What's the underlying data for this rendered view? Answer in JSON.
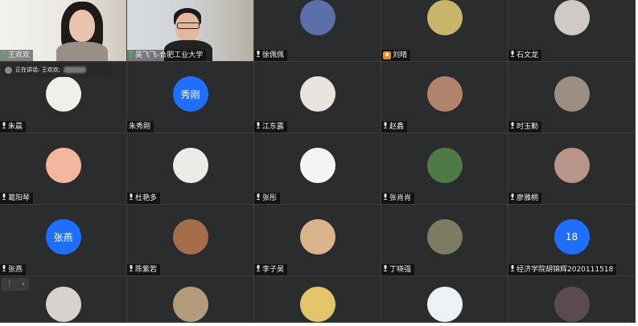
{
  "participants": [
    {
      "name": "王欢欢",
      "type": "video",
      "mic": true
    },
    {
      "name": "吴飞飞-合肥工业大学",
      "type": "video",
      "mic": true
    },
    {
      "name": "徐佩佩",
      "type": "image",
      "color": "#5b6fa8",
      "mic": true
    },
    {
      "name": "刘晴",
      "type": "image",
      "color": "#c9b56a",
      "badge": true
    },
    {
      "name": "石文龙",
      "type": "image",
      "color": "#cfcac4",
      "mic": true
    },
    {
      "name": "朱晨",
      "type": "image",
      "color": "#f1efe9",
      "mic": true
    },
    {
      "name": "朱秀刚",
      "type": "text",
      "text": "秀刚"
    },
    {
      "name": "江东露",
      "type": "image",
      "color": "#e8e4dd",
      "mic": true
    },
    {
      "name": "赵鑫",
      "type": "image",
      "color": "#b0836a",
      "mic": true
    },
    {
      "name": "时玉勤",
      "type": "image",
      "color": "#9c8f82",
      "mic": true
    },
    {
      "name": "葛阳琴",
      "type": "image",
      "color": "#f2b79d",
      "mic": true
    },
    {
      "name": "杜艳多",
      "type": "image",
      "color": "#ecebe6",
      "mic": true
    },
    {
      "name": "张彤",
      "type": "image",
      "color": "#f4f4f4",
      "mic": true
    },
    {
      "name": "张肖肖",
      "type": "image",
      "color": "#4d7a45",
      "mic": true
    },
    {
      "name": "廖雅桐",
      "type": "image",
      "color": "#b89588",
      "mic": true
    },
    {
      "name": "张燕",
      "type": "text",
      "text": "张燕",
      "mic": true
    },
    {
      "name": "陈紫若",
      "type": "image",
      "color": "#a56d4a",
      "mic": true
    },
    {
      "name": "李子昊",
      "type": "image",
      "color": "#d9b38b",
      "mic": true
    },
    {
      "name": "丁晓强",
      "type": "image",
      "color": "#7c7c62",
      "mic": true
    },
    {
      "name": "经济学院胡锦辉2020111518",
      "type": "text",
      "text": "18",
      "mic": true
    },
    {
      "name": "",
      "type": "image",
      "color": "#d7d2cc"
    },
    {
      "name": "",
      "type": "image",
      "color": "#b39a7a"
    },
    {
      "name": "",
      "type": "image",
      "color": "#e2c46a"
    },
    {
      "name": "",
      "type": "image",
      "color": "#eef1f3"
    },
    {
      "name": "",
      "type": "image",
      "color": "#5c4b4e"
    }
  ],
  "speaking_label": "正在讲话: 王欢欢;",
  "collapse": {
    "left": "⋮",
    "arrow": "‹"
  },
  "colors": {
    "accent": "#1f6fff",
    "badge": "#f08a24",
    "tile": "#2b2c2e"
  }
}
